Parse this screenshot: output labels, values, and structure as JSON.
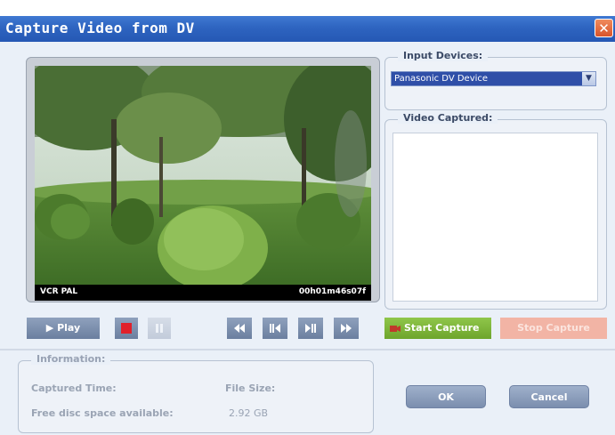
{
  "window": {
    "title": "Capture Video from DV",
    "close_icon": "close-icon",
    "close_glyph": "✕"
  },
  "video": {
    "format_label": "VCR PAL",
    "timecode": "00h01m46s07f"
  },
  "controls": {
    "play_label": "▶ Play",
    "stop_color": "#e0202a"
  },
  "input_devices": {
    "label": "Input Devices:",
    "selected": "Panasonic DV Device",
    "dropdown_glyph": "▼"
  },
  "video_captured": {
    "label": "Video Captured:",
    "items": []
  },
  "capture": {
    "start_label": "Start Capture",
    "stop_label": "Stop Capture"
  },
  "information": {
    "label": "Information:",
    "captured_time_label": "Captured Time:",
    "file_size_label": "File Size:",
    "free_space_label": "Free disc space available:",
    "free_space_value": "2.92 GB"
  },
  "buttons": {
    "ok": "OK",
    "cancel": "Cancel"
  },
  "colors": {
    "titlebar": "#2e64c0",
    "start_capture": "#7db43a",
    "stop_capture_disabled": "#f2b4a5"
  }
}
